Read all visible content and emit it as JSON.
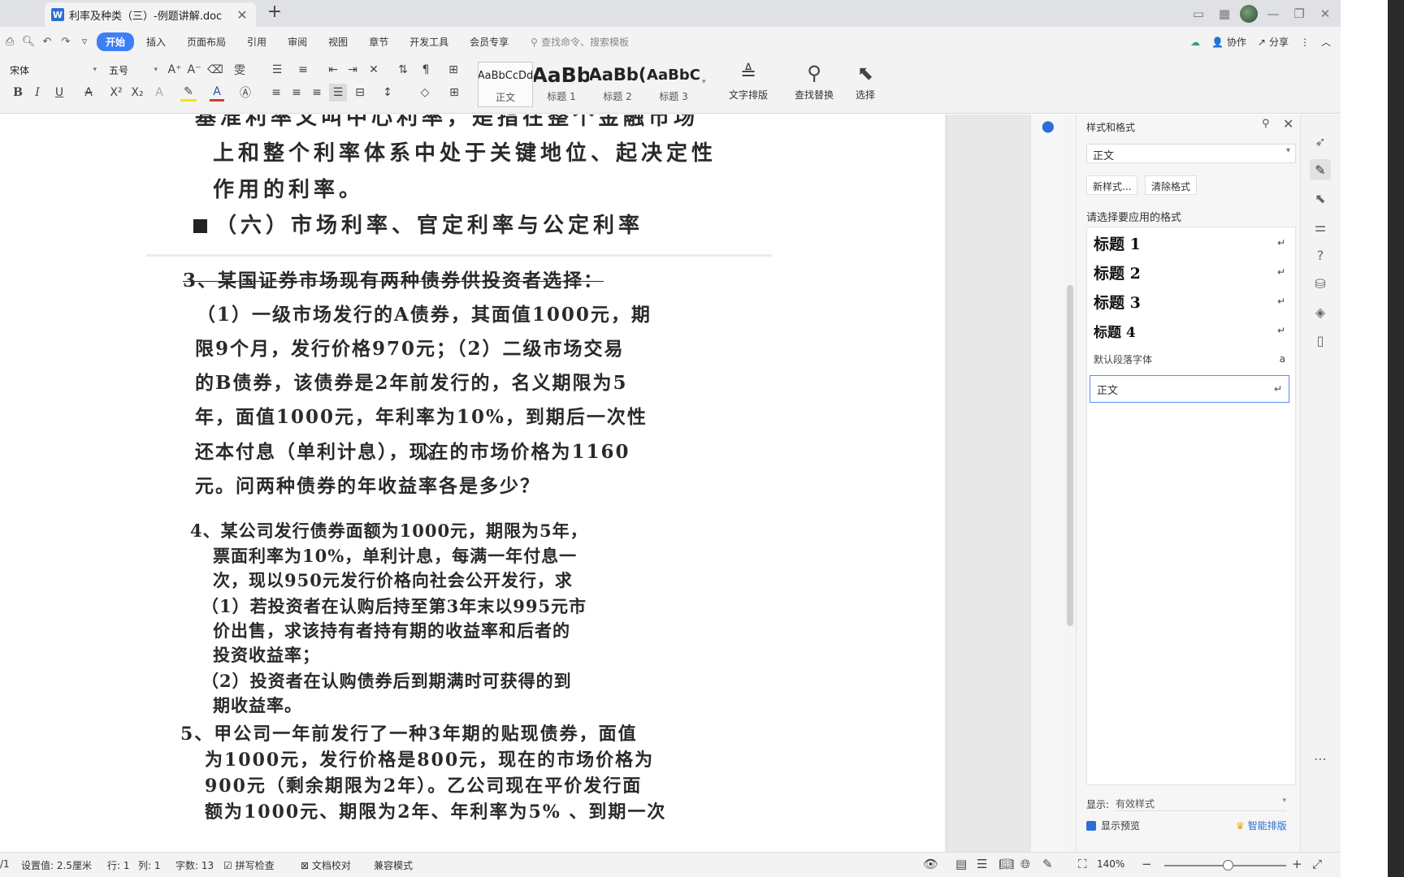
{
  "tab": {
    "icon": "W",
    "title": "利率及种类（三）-例题讲解.doc",
    "add": "+"
  },
  "menu": {
    "items": [
      "开始",
      "插入",
      "页面布局",
      "引用",
      "审阅",
      "视图",
      "章节",
      "开发工具",
      "会员专享"
    ],
    "search_placeholder": "查找命令、搜索模板",
    "collab": "协作",
    "share": "分享"
  },
  "ribbon": {
    "font_name": "宋体",
    "font_size": "五号",
    "styles": [
      {
        "preview": "AaBbCcDd",
        "label": "正文"
      },
      {
        "preview": "AaBb",
        "label": "标题 1"
      },
      {
        "preview": "AaBb(",
        "label": "标题 2"
      },
      {
        "preview": "AaBbC",
        "label": "标题 3"
      }
    ],
    "text_layout": "文字排版",
    "find_replace": "查找替换",
    "select": "选择"
  },
  "document": {
    "lines_top": [
      "基准利率又叫中心利率，是指在整个金融市场",
      "上和整个利率体系中处于关键地位、起决定性",
      "作用的利率。"
    ],
    "heading_six": "（六）市场利率、官定利率与公定利率",
    "q3": [
      "3、某国证券市场现有两种债券供投资者选择：",
      "（1）一级市场发行的A债券，其面值1000元，期",
      "限9个月，发行价格970元；（2）二级市场交易",
      "的B债券，该债券是2年前发行的，名义期限为5",
      "年，面值1000元，年利率为10%，到期后一次性",
      "还本付息（单利计息），现在的市场价格为1160",
      "元。问两种债券的年收益率各是多少？"
    ],
    "q4": [
      "4、某公司发行债券面额为1000元，期限为5年，",
      "票面利率为10%，单利计息，每满一年付息一",
      "次，现以950元发行价格向社会公开发行，求",
      "（1）若投资者在认购后持至第3年末以995元市",
      "价出售，求该持有者持有期的收益率和后者的",
      "投资收益率；",
      "（2）投资者在认购债券后到期满时可获得的到",
      "期收益率。"
    ],
    "q5": [
      "5、甲公司一年前发行了一种3年期的贴现债券，面值",
      "为1000元，发行价格是800元，现在的市场价格为",
      "900元（剩余期限为2年）。乙公司现在平价发行面",
      "额为1000元、期限为2年、年利率为5% 、到期一次"
    ]
  },
  "style_pane": {
    "title": "样式和格式",
    "current": "正文",
    "new_style": "新样式...",
    "clear_format": "清除格式",
    "hint": "请选择要应用的格式",
    "items": [
      {
        "name": "标题 1",
        "mark": "↵"
      },
      {
        "name": "标题 2",
        "mark": "↵"
      },
      {
        "name": "标题 3",
        "mark": "↵"
      },
      {
        "name": "标题 4",
        "mark": "↵"
      },
      {
        "name": "默认段落字体",
        "mark": "a"
      },
      {
        "name": "正文",
        "mark": "↵"
      }
    ],
    "show_label": "显示:",
    "show_value": "有效样式",
    "preview_label": "显示预览",
    "smart_layout": "智能排版"
  },
  "status": {
    "page": "/1",
    "setting": "设置值: 2.5厘米",
    "row": "行: 1",
    "col": "列: 1",
    "chars": "字数: 13",
    "spell": "拼写检查",
    "proof": "文档校对",
    "compat": "兼容模式",
    "zoom": "140%"
  }
}
